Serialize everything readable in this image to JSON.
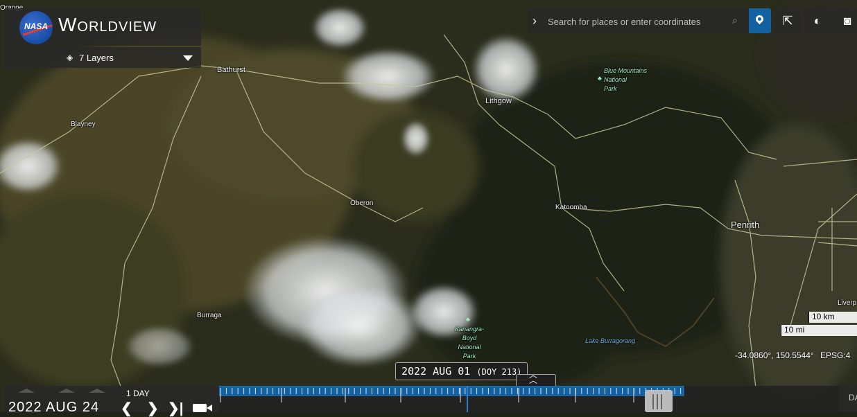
{
  "app": {
    "title": "Worldview",
    "logo_text": "NASA"
  },
  "layers": {
    "label": "7 Layers"
  },
  "search": {
    "placeholder": "Search for places or enter coordinates"
  },
  "toolbar": {
    "icons": [
      "share-icon",
      "projection-icon",
      "camera-icon"
    ]
  },
  "map": {
    "places": {
      "orange": "Orange",
      "bathurst": "Bathurst",
      "blayney": "Blayney",
      "lithgow": "Lithgow",
      "oberon": "Oberon",
      "katoomba": "Katoomba",
      "penrith": "Penrith",
      "burraga": "Burraga",
      "liverpool": "Liverp"
    },
    "parks": {
      "blue_mountains": "Blue Mountains\nNational\nPark",
      "kanangra": "Kanangra-\nBoyd\nNational\nPark"
    },
    "lake": "Lake Burragorang",
    "scale": {
      "km": "10 km",
      "mi": "10 mi"
    },
    "coordinates": "-34.0860°, 150.5544°",
    "projection": "EPSG:4"
  },
  "timeline": {
    "date": "2022 AUG 24",
    "interval": "1 DAY",
    "hover_date": "2022 AUG 01",
    "hover_doy": "(DOY 213)",
    "right_label": "DA"
  },
  "colors": {
    "accent": "#1261a0",
    "park_label": "#a6f0c6",
    "lake_label": "#6fa8dc",
    "timeline_tick": "#2a7fd4"
  }
}
